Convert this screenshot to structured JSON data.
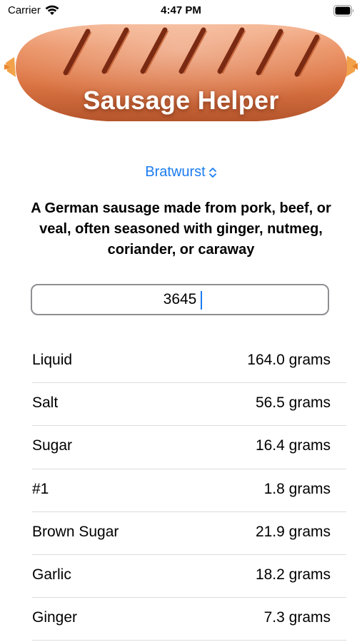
{
  "status_bar": {
    "carrier": "Carrier",
    "time": "4:47 PM"
  },
  "hero": {
    "title": "Sausage Helper"
  },
  "picker": {
    "selected": "Bratwurst",
    "icon": "chevron-up-down-icon",
    "color": "#1a7cf0"
  },
  "description": "A German sausage made from pork, beef, or veal, often seasoned with ginger, nutmeg, coriander, or caraway",
  "weight_input": {
    "value": "3645"
  },
  "ingredients": [
    {
      "name": "Liquid",
      "amount": "164.0 grams"
    },
    {
      "name": "Salt",
      "amount": "56.5 grams"
    },
    {
      "name": "Sugar",
      "amount": "16.4 grams"
    },
    {
      "name": "#1",
      "amount": "1.8 grams"
    },
    {
      "name": "Brown Sugar",
      "amount": "21.9 grams"
    },
    {
      "name": "Garlic",
      "amount": "18.2 grams"
    },
    {
      "name": "Ginger",
      "amount": "7.3 grams"
    }
  ]
}
